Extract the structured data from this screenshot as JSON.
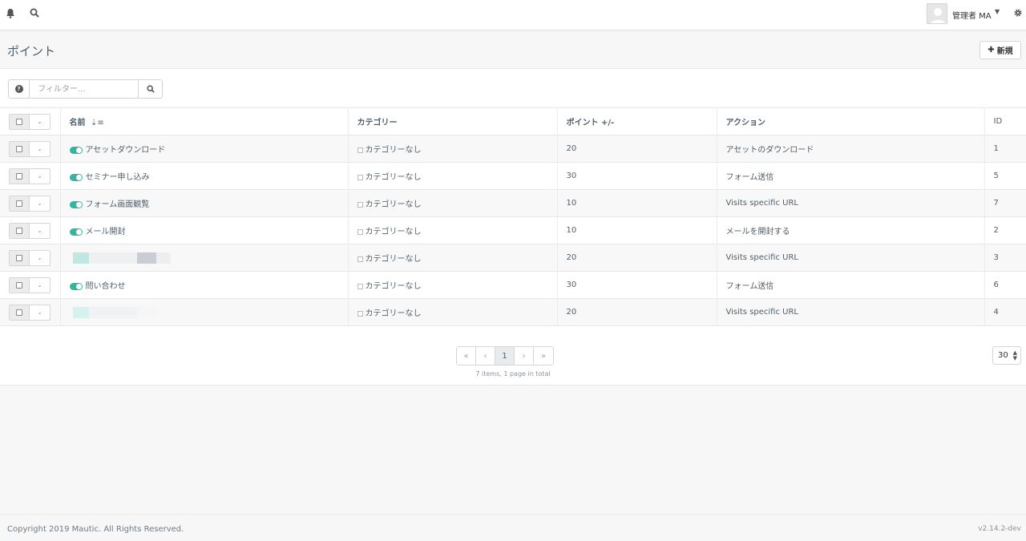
{
  "topbar": {
    "user_name": "管理者 MA",
    "icons": [
      "bell-icon",
      "search-icon",
      "avatar",
      "gear-icon"
    ]
  },
  "header": {
    "title": "ポイント",
    "new_button": "新規"
  },
  "filter": {
    "placeholder": "フィルター..."
  },
  "table": {
    "columns": [
      "名前",
      "カテゴリー",
      "ポイント +/-",
      "アクション",
      "ID"
    ],
    "rows": [
      {
        "name": "アセットダウンロード",
        "category": "カテゴリーなし",
        "points": "20",
        "action": "アセットのダウンロード",
        "id": "1",
        "published": true
      },
      {
        "name": "セミナー申し込み",
        "category": "カテゴリーなし",
        "points": "30",
        "action": "フォーム送信",
        "id": "5",
        "published": true
      },
      {
        "name": "フォーム画面観覧",
        "category": "カテゴリーなし",
        "points": "10",
        "action": "Visits specific URL",
        "id": "7",
        "published": true
      },
      {
        "name": "メール開封",
        "category": "カテゴリーなし",
        "points": "10",
        "action": "メールを開封する",
        "id": "2",
        "published": true
      },
      {
        "name": "",
        "category": "カテゴリーなし",
        "points": "20",
        "action": "Visits specific URL",
        "id": "3",
        "published": null
      },
      {
        "name": "問い合わせ",
        "category": "カテゴリーなし",
        "points": "30",
        "action": "フォーム送信",
        "id": "6",
        "published": true
      },
      {
        "name": "",
        "category": "カテゴリーなし",
        "points": "20",
        "action": "Visits specific URL",
        "id": "4",
        "published": null
      }
    ]
  },
  "pagination": {
    "first": "«",
    "prev": "‹",
    "current": "1",
    "next": "›",
    "last": "»",
    "info": "7 items, 1 page in total",
    "per_page": "30"
  },
  "footer": {
    "copyright": "Copyright 2019 Mautic. All Rights Reserved.",
    "version": "v2.14.2-dev"
  },
  "colors": {
    "toggle_on": "#35b5a0",
    "text": "#4e5e6a"
  }
}
